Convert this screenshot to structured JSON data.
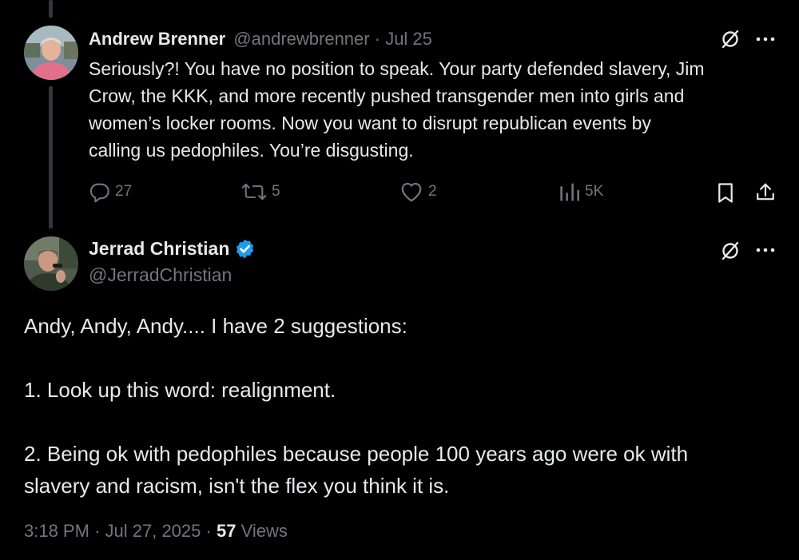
{
  "reply": {
    "name": "Andrew Brenner",
    "handle": "@andrewbrenner",
    "date": "Jul 25",
    "lines": [
      "Seriously?! You have no position to speak. Your party defended slavery, Jim",
      "Crow, the KKK, and more recently pushed transgender men into girls and",
      "women’s locker rooms. Now you want to disrupt republican events by",
      "calling us pedophiles. You’re disgusting."
    ],
    "actions": {
      "replies": "27",
      "reposts": "5",
      "likes": "2",
      "views": "5K"
    }
  },
  "main": {
    "name": "Jerrad Christian",
    "handle": "@JerradChristian",
    "verified": true,
    "lines": [
      "Andy, Andy, Andy.... I have 2 suggestions:",
      "",
      "1. Look up this word: realignment.",
      "",
      "2. Being ok with pedophiles because people 100 years ago were ok with",
      "slavery and racism, isn't the flex you think it is."
    ],
    "time": "3:18 PM",
    "full_date": "Jul 27, 2025",
    "views_count": "57",
    "views_label": "Views"
  },
  "colors": {
    "background": "#000000",
    "text": "#e7e9ea",
    "muted": "#71767b",
    "verified": "#1d9bf0",
    "thread_line": "#333639"
  },
  "icons": [
    "grok-icon",
    "more-icon",
    "reply-icon",
    "repost-icon",
    "like-icon",
    "views-icon",
    "bookmark-icon",
    "share-icon",
    "verified-badge-icon"
  ]
}
